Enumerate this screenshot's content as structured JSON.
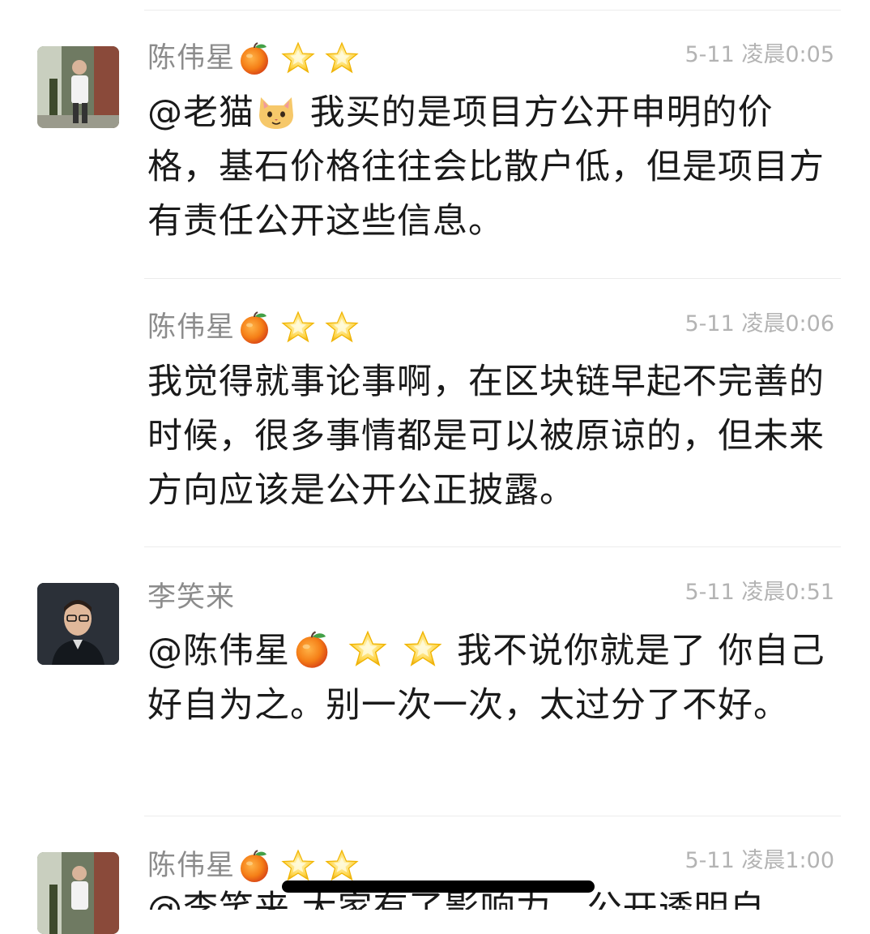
{
  "comments": [
    {
      "author": "陈伟星",
      "badges": [
        "orange-icon",
        "star-icon",
        "star-icon"
      ],
      "time": "5-11 凌晨0:05",
      "mention": "@老猫",
      "mention_icon": "cat-face-icon",
      "text": "我买的是项目方公开申明的价格，基石价格往往会比散户低，但是项目方有责任公开这些信息。"
    },
    {
      "author": "陈伟星",
      "badges": [
        "orange-icon",
        "star-icon",
        "star-icon"
      ],
      "time": "5-11 凌晨0:06",
      "text": "我觉得就事论事啊，在区块链早起不完善的时候，很多事情都是可以被原谅的，但未来方向应该是公开公正披露。"
    },
    {
      "author": "李笑来",
      "time": "5-11 凌晨0:51",
      "mention": "@陈伟星",
      "mention_icons": [
        "orange-icon",
        "star-icon",
        "star-icon"
      ],
      "text": "我不说你就是了 你自己好自为之。别一次一次，太过分了不好。"
    },
    {
      "author": "陈伟星",
      "badges": [
        "orange-icon",
        "star-icon",
        "star-icon"
      ],
      "time": "5-11 凌晨1:00",
      "text": "@李笑来 大家有了影响力，公开透明自"
    }
  ]
}
